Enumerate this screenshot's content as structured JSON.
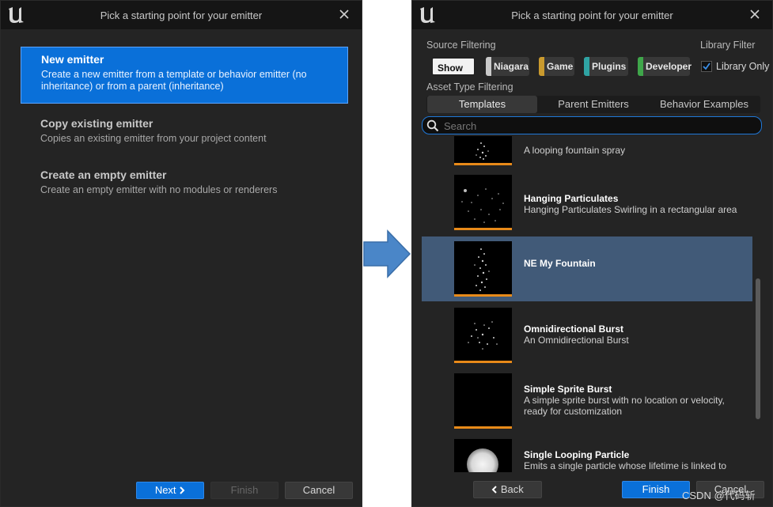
{
  "left_dialog": {
    "title": "Pick a starting point for your emitter",
    "options": [
      {
        "title": "New emitter",
        "desc": "Create a new emitter from a template or behavior emitter (no inheritance) or from a parent (inheritance)",
        "selected": true
      },
      {
        "title": "Copy existing emitter",
        "desc": "Copies an existing emitter from your project content",
        "selected": false
      },
      {
        "title": "Create an empty emitter",
        "desc": "Create an empty emitter with no modules or renderers",
        "selected": false
      }
    ],
    "buttons": {
      "next": "Next",
      "finish": "Finish",
      "cancel": "Cancel"
    }
  },
  "right_dialog": {
    "title": "Pick a starting point for your emitter",
    "source_filtering_label": "Source Filtering",
    "library_filter_label": "Library Filter",
    "source_chips": [
      {
        "label": "Show all",
        "color": "#f2f2f2"
      },
      {
        "label": "Niagara",
        "color": "#c9c9c9"
      },
      {
        "label": "Game",
        "color": "#c99a2e"
      },
      {
        "label": "Plugins",
        "color": "#2fa3a3"
      },
      {
        "label": "Developer",
        "color": "#3fa64a"
      }
    ],
    "library_only_label": "Library Only",
    "library_only_checked": true,
    "asset_type_label": "Asset Type Filtering",
    "tabs": [
      "Templates",
      "Parent Emitters",
      "Behavior Examples"
    ],
    "active_tab": "Templates",
    "search_placeholder": "Search",
    "assets": [
      {
        "title": "",
        "desc": "A looping fountain spray"
      },
      {
        "title": "Hanging Particulates",
        "desc": "Hanging Particulates Swirling in a rectangular area"
      },
      {
        "title": "NE My Fountain",
        "desc": ""
      },
      {
        "title": "Omnidirectional Burst",
        "desc": "An Omnidirectional Burst"
      },
      {
        "title": "Simple Sprite Burst",
        "desc": "A simple sprite burst with no location or velocity, ready for customization"
      },
      {
        "title": "Single Looping Particle",
        "desc": "Emits a single particle whose lifetime is linked to"
      }
    ],
    "selected_asset": "NE My Fountain",
    "buttons": {
      "back": "Back",
      "finish": "Finish",
      "cancel": "Cancel"
    }
  },
  "watermark": "CSDN @代码斩",
  "colors": {
    "accent": "#0a70d9",
    "selection": "#415a78",
    "thumb_bar": "#e88a19"
  }
}
